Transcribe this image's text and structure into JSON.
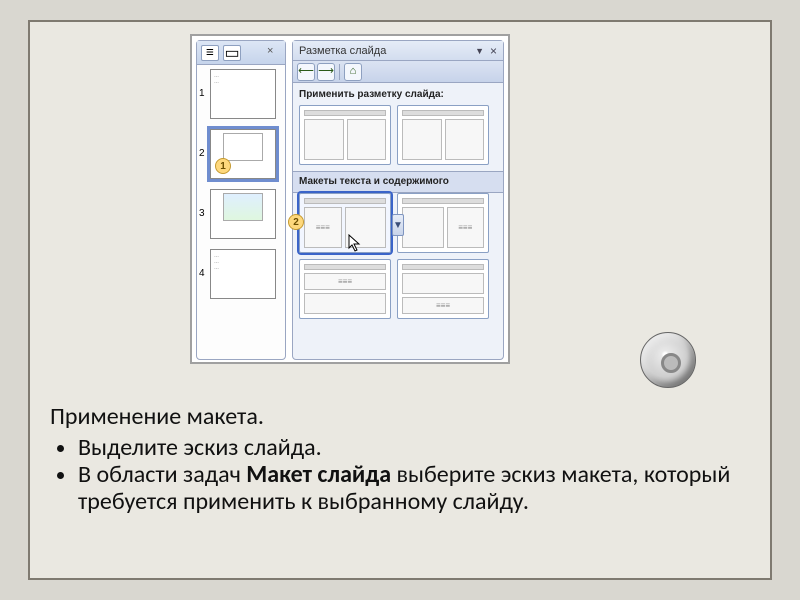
{
  "taskpane": {
    "title": "Разметка слайда",
    "apply_label": "Применить разметку слайда:",
    "section_label": "Макеты текста и содержимого"
  },
  "thumbnails": {
    "nums": [
      "1",
      "2",
      "3",
      "4"
    ]
  },
  "callouts": {
    "c1": "1",
    "c2": "2"
  },
  "symbols": {
    "close": "×",
    "dropdown": "▼",
    "back": "⟵",
    "fwd": "⟶",
    "home": "⌂",
    "outline": "≡",
    "slides": "▭"
  },
  "text": {
    "heading": "Применение макета.",
    "bullet1": "Выделите эскиз слайда.",
    "bullet2_pre": "В области задач ",
    "bullet2_bold": "Макет слайда",
    "bullet2_post": " выберите эскиз макета, который требуется применить к выбранному слайду."
  }
}
